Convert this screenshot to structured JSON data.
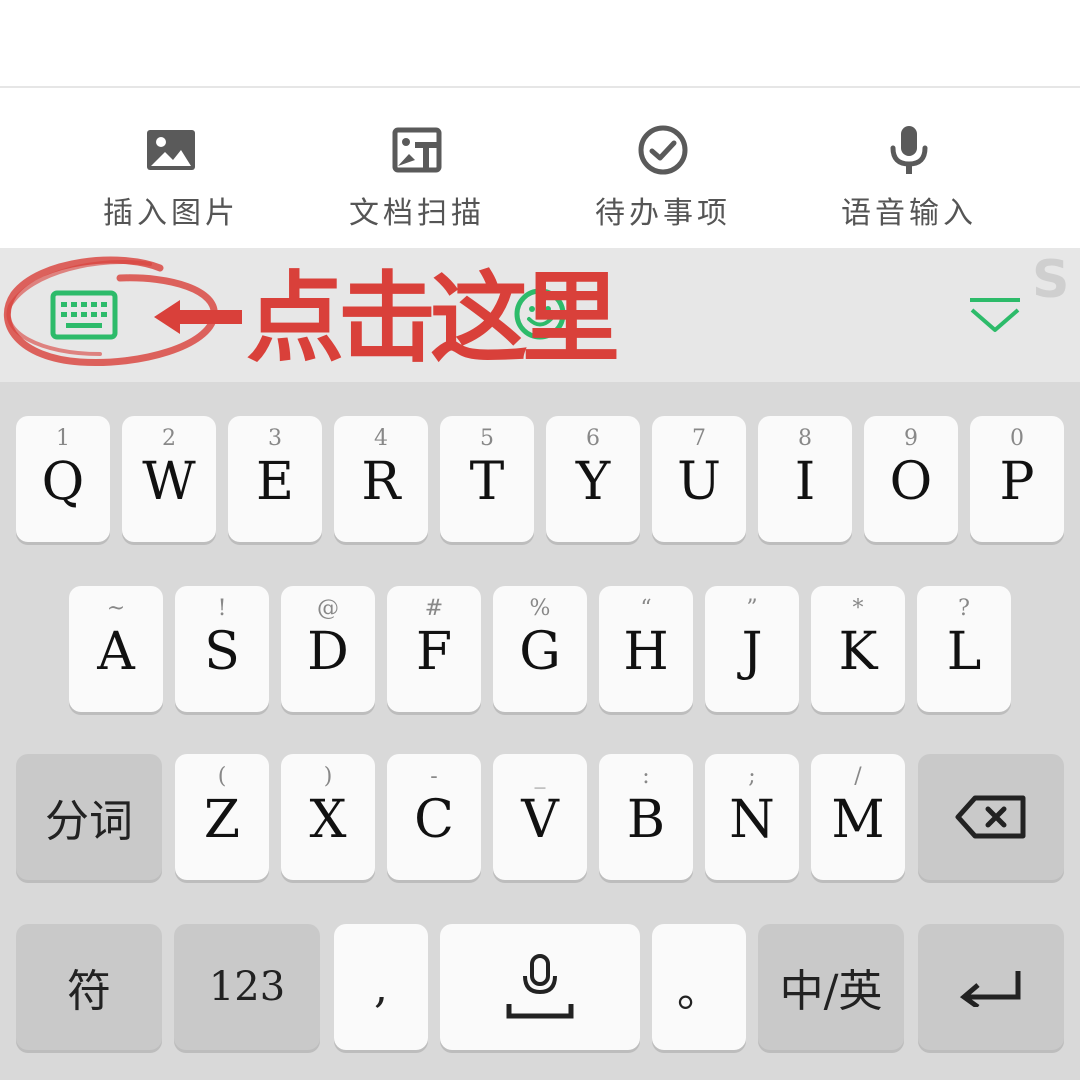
{
  "toolbar": {
    "items": [
      {
        "label": "插入图片",
        "icon": "image-icon"
      },
      {
        "label": "文档扫描",
        "icon": "scan-icon"
      },
      {
        "label": "待办事项",
        "icon": "check-circle-icon"
      },
      {
        "label": "语音输入",
        "icon": "microphone-icon"
      }
    ]
  },
  "suggestion_bar": {
    "annotation_text": "点击这里",
    "accent_color": "#2dbb6a",
    "annotation_color": "#d9403a",
    "corner_letter": "S"
  },
  "keyboard": {
    "row1": [
      {
        "main": "Q",
        "sub": "1"
      },
      {
        "main": "W",
        "sub": "2"
      },
      {
        "main": "E",
        "sub": "3"
      },
      {
        "main": "R",
        "sub": "4"
      },
      {
        "main": "T",
        "sub": "5"
      },
      {
        "main": "Y",
        "sub": "6"
      },
      {
        "main": "U",
        "sub": "7"
      },
      {
        "main": "I",
        "sub": "8"
      },
      {
        "main": "O",
        "sub": "9"
      },
      {
        "main": "P",
        "sub": "0"
      }
    ],
    "row2": [
      {
        "main": "A",
        "sub": "~"
      },
      {
        "main": "S",
        "sub": "!"
      },
      {
        "main": "D",
        "sub": "@"
      },
      {
        "main": "F",
        "sub": "#"
      },
      {
        "main": "G",
        "sub": "%"
      },
      {
        "main": "H",
        "sub": "“"
      },
      {
        "main": "J",
        "sub": "”"
      },
      {
        "main": "K",
        "sub": "*"
      },
      {
        "main": "L",
        "sub": "?"
      }
    ],
    "row3": [
      {
        "main": "Z",
        "sub": "("
      },
      {
        "main": "X",
        "sub": ")"
      },
      {
        "main": "C",
        "sub": "-"
      },
      {
        "main": "V",
        "sub": "_"
      },
      {
        "main": "B",
        "sub": ":"
      },
      {
        "main": "N",
        "sub": ";"
      },
      {
        "main": "M",
        "sub": "/"
      }
    ],
    "segment_label": "分词",
    "symbols_label": "符",
    "numbers_label": "123",
    "comma_label": ",",
    "period_label": "。",
    "lang_label": "中/英"
  }
}
